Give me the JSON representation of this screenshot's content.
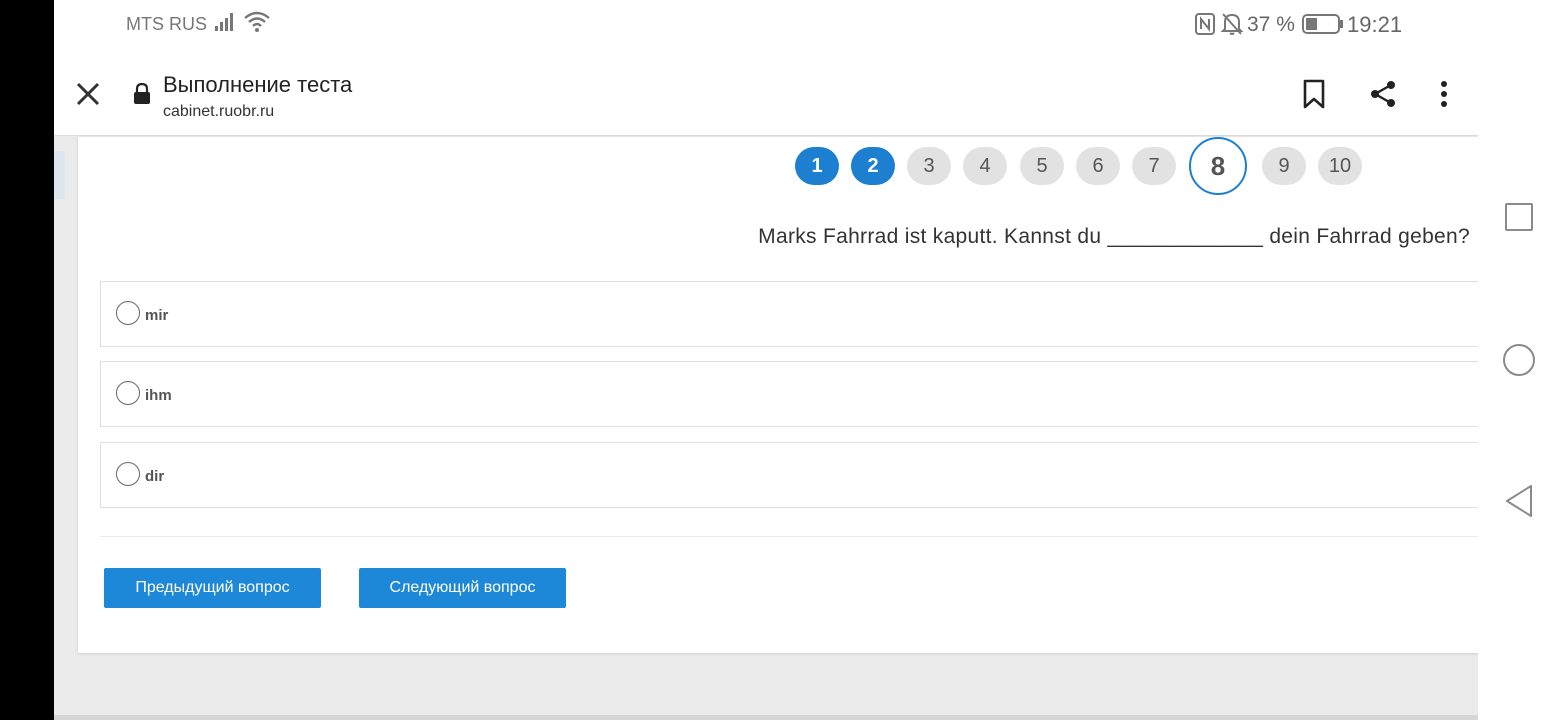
{
  "status_bar": {
    "carrier": "MTS RUS",
    "battery_percent": "37 %",
    "time": "19:21",
    "battery_level": 0.37
  },
  "browser": {
    "title": "Выполнение теста",
    "url": "cabinet.ruobr.ru"
  },
  "pager": {
    "pages": [
      {
        "label": "1",
        "state": "answered"
      },
      {
        "label": "2",
        "state": "answered"
      },
      {
        "label": "3",
        "state": "default"
      },
      {
        "label": "4",
        "state": "default"
      },
      {
        "label": "5",
        "state": "default"
      },
      {
        "label": "6",
        "state": "default"
      },
      {
        "label": "7",
        "state": "default"
      },
      {
        "label": "8",
        "state": "current"
      },
      {
        "label": "9",
        "state": "default"
      },
      {
        "label": "10",
        "state": "default"
      }
    ]
  },
  "question": {
    "text": "Marks Fahrrad ist kaputt. Kannst du _____________ dein Fahrrad geben?"
  },
  "options": [
    {
      "label": "mir"
    },
    {
      "label": "ihm"
    },
    {
      "label": "dir"
    }
  ],
  "buttons": {
    "prev": "Предыдущий вопрос",
    "next": "Следующий вопрос"
  },
  "colors": {
    "accent": "#1c7fcf",
    "button": "#1e88d8",
    "background": "#ebebeb"
  }
}
